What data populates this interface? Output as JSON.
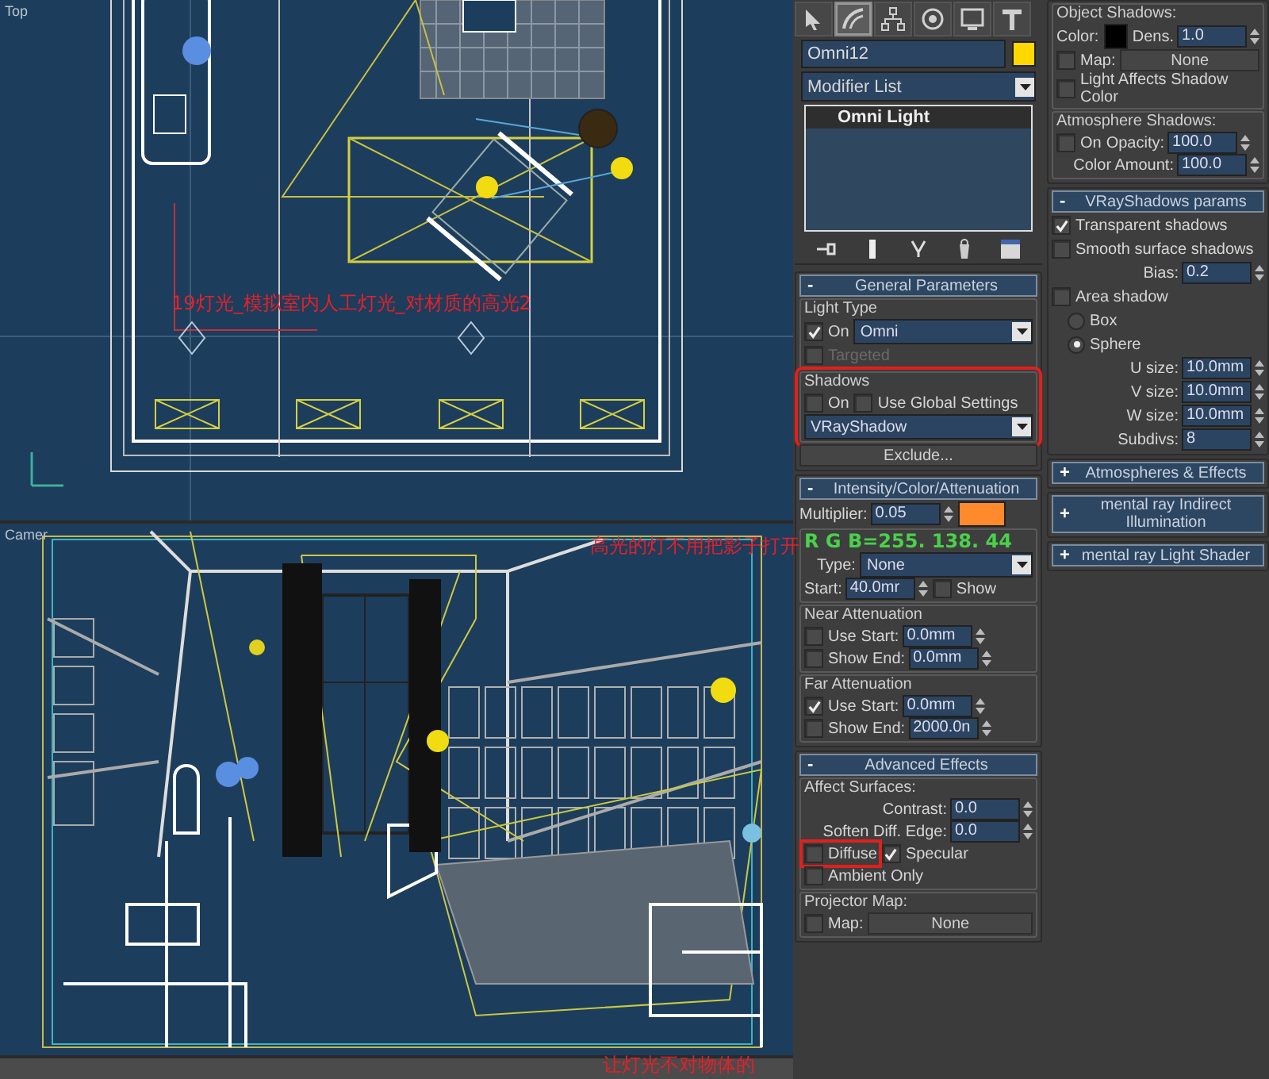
{
  "viewports": [
    {
      "kind": "top",
      "label": "Top"
    },
    {
      "kind": "camera",
      "label": "Camer"
    }
  ],
  "command_panel": {
    "tabs": [
      {
        "selected": false
      },
      {
        "selected": true
      },
      {
        "selected": false
      },
      {
        "selected": false
      },
      {
        "selected": false
      },
      {
        "selected": false
      }
    ],
    "object": {
      "name": "Omni12",
      "color": "#ffd800"
    },
    "modifier_list": "Modifier List",
    "stack": [
      "Omni Light"
    ],
    "left_rollouts": [
      {
        "sign": "-",
        "title": "General Parameters",
        "content": [
          {
            "kind": "group",
            "title": "Light Type",
            "rows": [
              {
                "items": [
                  {
                    "kind": "check",
                    "label": "On",
                    "checked": true
                  },
                  {
                    "kind": "dropdown",
                    "value": "Omni"
                  }
                ]
              },
              {
                "items": [
                  {
                    "kind": "check",
                    "label": "Targeted",
                    "checked": false,
                    "disabled": true
                  }
                ]
              }
            ]
          },
          {
            "kind": "group",
            "title": "Shadows",
            "highlighted": true,
            "rows": [
              {
                "items": [
                  {
                    "kind": "check",
                    "label": "On",
                    "checked": false
                  },
                  {
                    "kind": "check",
                    "label": "Use Global Settings",
                    "checked": false
                  }
                ]
              },
              {
                "items": [
                  {
                    "kind": "dropdown",
                    "value": "VRayShadow"
                  }
                ]
              }
            ]
          },
          {
            "kind": "row",
            "items": [
              {
                "kind": "button",
                "label": "Exclude..."
              }
            ]
          }
        ]
      },
      {
        "sign": "-",
        "title": "Intensity/Color/Attenuation",
        "content": [
          {
            "kind": "row",
            "items": [
              {
                "kind": "spinner",
                "label": "Multiplier:",
                "value": "0.05"
              },
              {
                "kind": "swatch",
                "color": "#ff8a2c"
              }
            ]
          },
          {
            "kind": "group",
            "rows": [
              {
                "items": [
                  {
                    "kind": "dropdown",
                    "label": "Type:",
                    "value": "None"
                  }
                ]
              },
              {
                "items": [
                  {
                    "kind": "spinner",
                    "label": "Start:",
                    "value": "40.0mr"
                  },
                  {
                    "kind": "check",
                    "label": "Show",
                    "checked": false
                  }
                ]
              }
            ]
          },
          {
            "kind": "group",
            "title": "Near Attenuation",
            "rows": [
              {
                "items": [
                  {
                    "kind": "check",
                    "label": "Use",
                    "checked": false
                  },
                  {
                    "kind": "spinner",
                    "label": "Start:",
                    "value": "0.0mm"
                  }
                ]
              },
              {
                "items": [
                  {
                    "kind": "check",
                    "label": "Show",
                    "checked": false
                  },
                  {
                    "kind": "spinner",
                    "label": "End:",
                    "value": "0.0mm"
                  }
                ]
              }
            ]
          },
          {
            "kind": "group",
            "title": "Far Attenuation",
            "rows": [
              {
                "items": [
                  {
                    "kind": "check",
                    "label": "Use",
                    "checked": true
                  },
                  {
                    "kind": "spinner",
                    "label": "Start:",
                    "value": "0.0mm"
                  }
                ]
              },
              {
                "items": [
                  {
                    "kind": "check",
                    "label": "Show",
                    "checked": false
                  },
                  {
                    "kind": "spinner",
                    "label": "End:",
                    "value": "2000.0n"
                  }
                ]
              }
            ]
          }
        ]
      },
      {
        "sign": "-",
        "title": "Advanced Effects",
        "content": [
          {
            "kind": "group",
            "title": "Affect Surfaces:",
            "rows": [
              {
                "items": [
                  {
                    "kind": "spinner",
                    "label": "Contrast:",
                    "value": "0.0"
                  }
                ]
              },
              {
                "items": [
                  {
                    "kind": "spinner",
                    "label": "Soften Diff. Edge:",
                    "value": "0.0"
                  }
                ]
              },
              {
                "items": [
                  {
                    "kind": "check",
                    "label": "Diffuse",
                    "checked": false,
                    "highlighted": true
                  },
                  {
                    "kind": "check",
                    "label": "Specular",
                    "checked": true
                  }
                ]
              },
              {
                "items": [
                  {
                    "kind": "check",
                    "label": "Ambient Only",
                    "checked": false
                  }
                ]
              }
            ]
          },
          {
            "kind": "group",
            "title": "Projector Map:",
            "rows": [
              {
                "items": [
                  {
                    "kind": "check",
                    "label": "Map:",
                    "checked": false
                  },
                  {
                    "kind": "button",
                    "label": "None"
                  }
                ]
              }
            ]
          }
        ]
      }
    ],
    "right_rollouts": [
      {
        "content": [
          {
            "kind": "group",
            "title": "Object Shadows:",
            "rows": [
              {
                "items": [
                  {
                    "kind": "label",
                    "text": "Color:"
                  },
                  {
                    "kind": "swatch",
                    "color": "#000000"
                  },
                  {
                    "kind": "spinner",
                    "label": "Dens.",
                    "value": "1.0"
                  }
                ]
              },
              {
                "items": [
                  {
                    "kind": "check",
                    "label": "Map:",
                    "checked": false
                  },
                  {
                    "kind": "button",
                    "label": "None"
                  }
                ]
              },
              {
                "items": [
                  {
                    "kind": "check",
                    "label": "Light Affects Shadow Color",
                    "checked": false
                  }
                ]
              }
            ]
          },
          {
            "kind": "group",
            "title": "Atmosphere Shadows:",
            "rows": [
              {
                "items": [
                  {
                    "kind": "check",
                    "label": "On",
                    "checked": false
                  },
                  {
                    "kind": "spinner",
                    "label": "Opacity:",
                    "value": "100.0"
                  }
                ]
              },
              {
                "items": [
                  {
                    "kind": "spinner",
                    "label": "Color Amount:",
                    "value": "100.0"
                  }
                ]
              }
            ]
          }
        ]
      },
      {
        "sign": "-",
        "title": "VRayShadows params",
        "content": [
          {
            "kind": "row",
            "items": [
              {
                "kind": "check",
                "label": "Transparent shadows",
                "checked": true
              }
            ]
          },
          {
            "kind": "row",
            "items": [
              {
                "kind": "check",
                "label": "Smooth surface shadows",
                "checked": false
              }
            ]
          },
          {
            "kind": "row",
            "items": [
              {
                "kind": "spinner",
                "label": "Bias:",
                "value": "0.2"
              }
            ]
          },
          {
            "kind": "row",
            "items": [
              {
                "kind": "check",
                "label": "Area shadow",
                "checked": false
              }
            ]
          },
          {
            "kind": "row",
            "items": [
              {
                "kind": "radio",
                "label": "Box",
                "selected": false
              }
            ]
          },
          {
            "kind": "row",
            "items": [
              {
                "kind": "radio",
                "label": "Sphere",
                "selected": true
              }
            ]
          },
          {
            "kind": "row",
            "items": [
              {
                "kind": "spinner",
                "label": "U size:",
                "value": "10.0mm"
              }
            ]
          },
          {
            "kind": "row",
            "items": [
              {
                "kind": "spinner",
                "label": "V size:",
                "value": "10.0mm"
              }
            ]
          },
          {
            "kind": "row",
            "items": [
              {
                "kind": "spinner",
                "label": "W size:",
                "value": "10.0mm"
              }
            ]
          },
          {
            "kind": "row",
            "items": [
              {
                "kind": "spinner",
                "label": "Subdivs:",
                "value": "8"
              }
            ]
          }
        ]
      },
      {
        "sign": "+",
        "title": "Atmospheres & Effects"
      },
      {
        "sign": "+",
        "title": "mental ray Indirect Illumination"
      },
      {
        "sign": "+",
        "title": "mental ray Light Shader"
      }
    ]
  },
  "annotations": [
    {
      "kind": "caption",
      "text": "19灯光_模拟室内人工灯光_对材质的高光2"
    },
    {
      "kind": "caption",
      "text": "高光的灯不用把影子打开"
    },
    {
      "kind": "note",
      "text": "R G B=255. 138. 44"
    },
    {
      "kind": "caption",
      "text": "让灯光不对物体的"
    }
  ]
}
